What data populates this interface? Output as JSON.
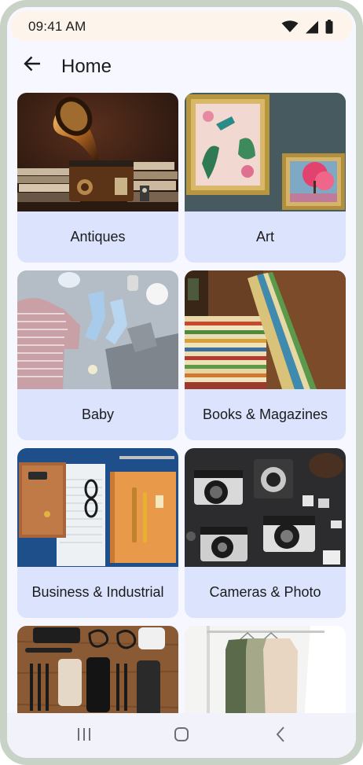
{
  "status_bar": {
    "time": "09:41 AM",
    "icons": [
      "wifi-icon",
      "cellular-signal-icon",
      "battery-icon"
    ]
  },
  "app_bar": {
    "back_icon": "arrow-back-icon",
    "title": "Home"
  },
  "categories": [
    {
      "label": "Antiques",
      "image": "gramophone-photo"
    },
    {
      "label": "Art",
      "image": "framed-paintings-photo"
    },
    {
      "label": "Baby",
      "image": "baby-clothes-photo"
    },
    {
      "label": "Books & Magazines",
      "image": "magazine-stack-photo"
    },
    {
      "label": "Business & Industrial",
      "image": "office-supplies-photo"
    },
    {
      "label": "Cameras & Photo",
      "image": "vintage-cameras-photo"
    },
    {
      "label": "",
      "image": "electronics-accessories-photo"
    },
    {
      "label": "",
      "image": "clothes-rack-photo"
    }
  ],
  "nav_bar": {
    "icons": [
      "recent-apps-icon",
      "home-icon",
      "back-icon"
    ]
  },
  "colors": {
    "card_background": "#dce3fc",
    "screen_background": "#f7f8ff",
    "status_bar_background": "#fdf4ec",
    "device_frame": "#c8d2c6"
  }
}
